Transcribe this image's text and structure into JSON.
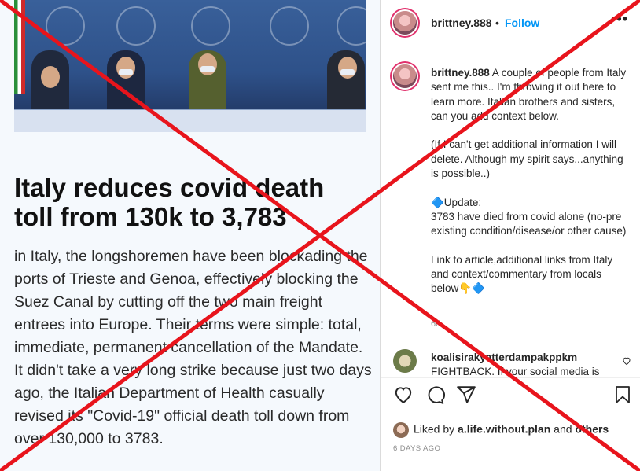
{
  "article": {
    "headline": "Italy reduces covid death toll from 130k to 3,783",
    "paragraph1": "in Italy, the longshoremen have been blockading the ports of Trieste and Genoa, effectively blocking the Suez Canal by cutting off the two main freight entrees into Europe. Their terms were simple: total, immediate, permanent cancellation of the Mandate.",
    "paragraph2": "It didn't take a very long strike because just two days ago, the Italian Department of Health casually revised its \"Covid-19\" official death toll down from over 130,000 to 3783."
  },
  "post": {
    "username": "brittney.888",
    "separator": "•",
    "follow_label": "Follow",
    "more_icon": "more-horizontal-icon",
    "caption_lines": [
      "A couple of people from Italy sent me this.. I'm throwing it out here to learn more. Italian brothers and sisters, can you add context below.",
      "",
      "(If I can't get additional information I will delete. Although my spirit says...anything is possible..)",
      "",
      "🔷Update:",
      "3783 have died from covid alone (no-pre existing condition/disease/or other cause)",
      "",
      "Link to article,additional links from Italy and context/commentary from locals below👇🔷"
    ],
    "caption_age": "6d"
  },
  "comment": {
    "username": "koalisirakyatterdampakppkm",
    "text": "FIGHTBACK. If your social media is"
  },
  "actions": {
    "liked_prefix": "Liked by",
    "liked_user": "a.life.without.plan",
    "liked_and": "and",
    "liked_others": "others",
    "timestamp": "6 DAYS AGO"
  },
  "colors": {
    "follow_blue": "#0095f6",
    "cross_red": "#e8141c"
  }
}
